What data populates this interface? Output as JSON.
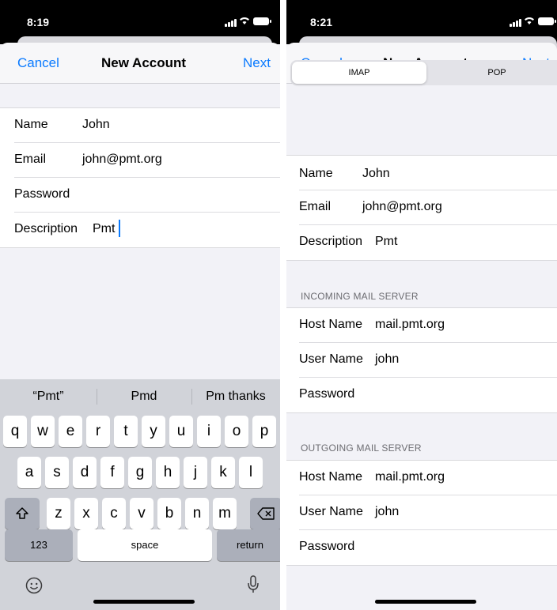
{
  "left": {
    "status": {
      "time": "8:19"
    },
    "nav": {
      "cancel": "Cancel",
      "title": "New Account",
      "next": "Next"
    },
    "fields": [
      {
        "label": "Name",
        "value": "John"
      },
      {
        "label": "Email",
        "value": "john@pmt.org"
      },
      {
        "label": "Password",
        "value": ""
      },
      {
        "label": "Description",
        "value": "Pmt"
      }
    ],
    "predictions": [
      "“Pmt”",
      "Pmd",
      "Pm thanks"
    ],
    "keyboard": {
      "row1": [
        "q",
        "w",
        "e",
        "r",
        "t",
        "y",
        "u",
        "i",
        "o",
        "p"
      ],
      "row2": [
        "a",
        "s",
        "d",
        "f",
        "g",
        "h",
        "j",
        "k",
        "l"
      ],
      "row3": [
        "z",
        "x",
        "c",
        "v",
        "b",
        "n",
        "m"
      ],
      "shift_icon": "shift-icon",
      "delete_icon": "delete-icon",
      "numbers": "123",
      "space": "space",
      "return": "return",
      "emoji_icon": "emoji-icon",
      "mic_icon": "microphone-icon"
    }
  },
  "right": {
    "status": {
      "time": "8:21"
    },
    "nav": {
      "cancel": "Cancel",
      "title": "New Account",
      "next": "Next"
    },
    "segment": {
      "options": [
        "IMAP",
        "POP"
      ],
      "selected": "IMAP"
    },
    "account": [
      {
        "label": "Name",
        "value": "John"
      },
      {
        "label": "Email",
        "value": "john@pmt.org"
      },
      {
        "label": "Description",
        "value": "Pmt"
      }
    ],
    "incoming": {
      "header": "INCOMING MAIL SERVER",
      "fields": [
        {
          "label": "Host Name",
          "value": "mail.pmt.org"
        },
        {
          "label": "User Name",
          "value": "john"
        },
        {
          "label": "Password",
          "value": ""
        }
      ]
    },
    "outgoing": {
      "header": "OUTGOING MAIL SERVER",
      "fields": [
        {
          "label": "Host Name",
          "value": "mail.pmt.org"
        },
        {
          "label": "User Name",
          "value": "john"
        },
        {
          "label": "Password",
          "value": ""
        }
      ]
    }
  },
  "colors": {
    "accent": "#0a7aff",
    "background": "#f2f2f7",
    "keyboard": "#d1d3d9"
  }
}
